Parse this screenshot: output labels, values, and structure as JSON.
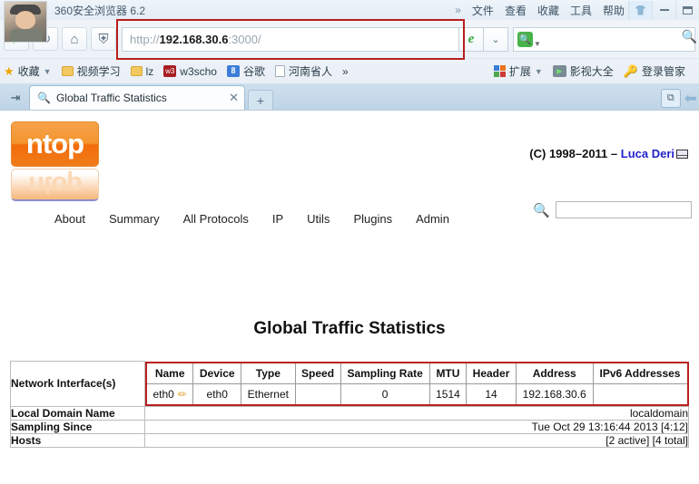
{
  "browser": {
    "name": "360安全浏览器 6.2",
    "title_menu": [
      {
        "label": "»",
        "name": "overflow-chevron"
      },
      {
        "label": "文件",
        "name": "menu-file"
      },
      {
        "label": "查看",
        "name": "menu-view"
      },
      {
        "label": "收藏",
        "name": "menu-favorites"
      },
      {
        "label": "工具",
        "name": "menu-tools"
      },
      {
        "label": "帮助",
        "name": "menu-help"
      }
    ],
    "window_controls": [
      "skin",
      "minimize",
      "maximize"
    ],
    "toolbar": {
      "back": "←",
      "refresh": "↻",
      "home": "⌂",
      "shield": "⛨",
      "url_scheme": "http://",
      "url_host": "192.168.30.6",
      "url_rest": ":3000/",
      "compat_icon": "e",
      "compat_caret": "⌄",
      "search_placeholder": "",
      "search_value": "",
      "search_icon_glyph": "🔍"
    },
    "bookmarks": [
      {
        "label": "收藏",
        "icon": "star-icon",
        "caret": true
      },
      {
        "label": "视频学习",
        "icon": "folder-icon",
        "caret": false
      },
      {
        "label": "lz",
        "icon": "folder-icon",
        "caret": false
      },
      {
        "label": "w3scho",
        "icon": "w3-icon",
        "caret": false
      },
      {
        "label": "谷歌",
        "icon": "google-icon",
        "caret": false
      },
      {
        "label": "河南省人",
        "icon": "page-icon",
        "caret": false
      },
      {
        "label": "»",
        "icon": "",
        "caret": false
      }
    ],
    "bookmarks_right": [
      {
        "label": "扩展",
        "icon": "extensions-icon",
        "caret": true
      },
      {
        "label": "影视大全",
        "icon": "film-icon",
        "caret": false
      },
      {
        "label": "登录管家",
        "icon": "key-icon",
        "caret": false
      }
    ],
    "tab": {
      "title": "Global Traffic Statistics",
      "close": "✕",
      "new_tab": "+"
    }
  },
  "content": {
    "logo_text": "ntop",
    "copyright_prefix": "(C) 1998–2011 – ",
    "copyright_author": "Luca Deri",
    "nav": [
      {
        "label": "About"
      },
      {
        "label": "Summary"
      },
      {
        "label": "All Protocols"
      },
      {
        "label": "IP"
      },
      {
        "label": "Utils"
      },
      {
        "label": "Plugins"
      },
      {
        "label": "Admin"
      }
    ],
    "site_search_value": "",
    "page_title": "Global Traffic Statistics",
    "table": {
      "interfaces_label": "Network Interface(s)",
      "interface_columns": [
        "Name",
        "Device",
        "Type",
        "Speed",
        "Sampling Rate",
        "MTU",
        "Header",
        "Address",
        "IPv6 Addresses"
      ],
      "interface_rows": [
        {
          "name": "eth0",
          "device": "eth0",
          "type": "Ethernet",
          "speed": "",
          "sampling_rate": "0",
          "mtu": "1514",
          "header": "14",
          "address": "192.168.30.6",
          "ipv6": ""
        }
      ],
      "rows": [
        {
          "label": "Local Domain Name",
          "value": "localdomain"
        },
        {
          "label": "Sampling Since",
          "value": "Tue Oct 29 13:16:44 2013 [4:12]"
        },
        {
          "label": "Hosts",
          "value": "[2 active] [4 total]"
        }
      ]
    }
  }
}
